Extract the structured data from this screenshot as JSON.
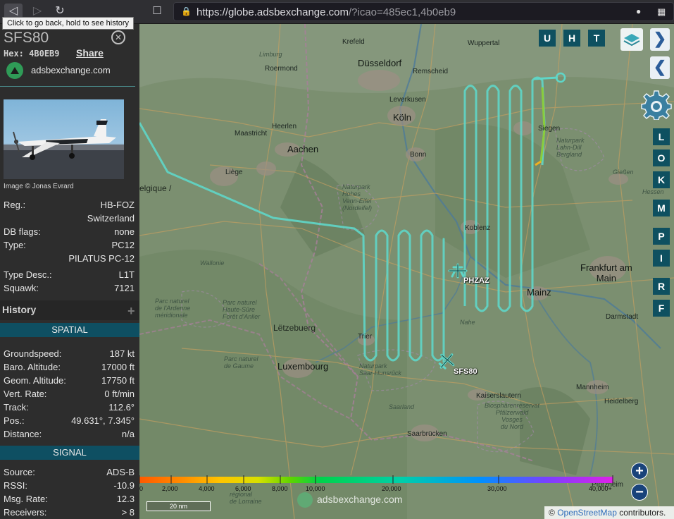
{
  "browser": {
    "url_host": "https://globe.adsbexchange.com",
    "url_path": "/?icao=485ec1,4b0eb9",
    "tooltip": "Click to go back, hold to see history"
  },
  "aircraft": {
    "callsign": "SFS80",
    "hex_label": "Hex:",
    "hex": "4B0EB9",
    "share_label": "Share",
    "site_name": "adsbexchange.com",
    "image_credit": "Image © Jonas Evrard"
  },
  "details": [
    {
      "key": "Reg.:",
      "value": "HB-FOZ"
    },
    {
      "key": "",
      "value": "Switzerland"
    },
    {
      "key": "DB flags:",
      "value": "none"
    },
    {
      "key": "Type:",
      "value": "PC12"
    },
    {
      "key": "",
      "value": "PILATUS PC-12"
    },
    {
      "key": "Type Desc.:",
      "value": "L1T"
    },
    {
      "key": "Squawk:",
      "value": "7121"
    }
  ],
  "history_label": "History",
  "spatial_label": "SPATIAL",
  "spatial": [
    {
      "key": "Groundspeed:",
      "value": "187 kt"
    },
    {
      "key": "Baro. Altitude:",
      "value": "17000 ft"
    },
    {
      "key": "Geom. Altitude:",
      "value": "17750 ft"
    },
    {
      "key": "Vert. Rate:",
      "value": "0 ft/min"
    },
    {
      "key": "Track:",
      "value": "112.6°"
    },
    {
      "key": "Pos.:",
      "value": "49.631°, 7.345°"
    },
    {
      "key": "Distance:",
      "value": "n/a"
    }
  ],
  "signal_label": "SIGNAL",
  "signal": [
    {
      "key": "Source:",
      "value": "ADS-B"
    },
    {
      "key": "RSSI:",
      "value": "-10.9"
    },
    {
      "key": "Msg. Rate:",
      "value": "12.3"
    },
    {
      "key": "Receivers:",
      "value": "> 8"
    }
  ],
  "map": {
    "buttons_top": [
      "U",
      "H",
      "T"
    ],
    "buttons_side": [
      "L",
      "O",
      "K",
      "M",
      "P",
      "I",
      "R",
      "F"
    ],
    "aircraft_labels": [
      "PHZAZ",
      "SFS80"
    ],
    "track_color": "#5fd6c8",
    "labels": {
      "krefeld": "Krefeld",
      "wuppertal": "Wuppertal",
      "limburg": "Limburg",
      "roermond": "Roermond",
      "dusseldorf": "Düsseldorf",
      "remscheid": "Remscheid",
      "leverkusen": "Leverkusen",
      "koln": "Köln",
      "heerlen": "Heerlen",
      "maastricht": "Maastricht",
      "aachen": "Aachen",
      "bonn": "Bonn",
      "liege": "Liège",
      "belgique": "elgique /",
      "siegen": "Siegen",
      "lahn": "Naturpark\nLahn-Dill\nBergland",
      "giessen": "Gießen",
      "eifel": "Naturpark\nHohes\nVenn-Eifel\n(Nordeifel)",
      "koblenz": "Koblenz",
      "frankfurt": "Frankfurt am\nMain",
      "wallonie": "Wallonie",
      "mainz": "Mainz",
      "darmstadt": "Darmstadt",
      "ardenne": "Parc naturel\nde l'Ardenne\nméridionale",
      "hautesure": "Parc naturel\nHaute-Sûre\nForêt d'Anlier",
      "letzebuerg": "Lëtzebuerg",
      "hunsruck": "Naturpark\nSaar-Hunsrück",
      "luxembourg": "Luxembourg",
      "gaume": "Parc naturel\nde Gaume",
      "trier": "Trier",
      "kaiserslautern": "Kaiserslautern",
      "pfalzer": "Biosphärenreservat\nPfälzerwald\nVosges\ndu Nord",
      "saarland": "Saarland",
      "saarbrucken": "Saarbrücken",
      "mannheim": "Mannheim",
      "heidelberg": "Heidelberg",
      "pforzheim": "Pforzheim",
      "lorraine": "régional\nde Lorraine",
      "nahe": "Nahe",
      "hessen": "Hessen"
    },
    "colorbar_ticks": [
      "0",
      "2,000",
      "4,000",
      "6,000",
      "8,000",
      "10,000",
      "20,000",
      "30,000",
      "40,000+"
    ],
    "scale_label": "20 nm",
    "watermark": "adsbexchange.com",
    "attribution_prefix": "©",
    "attribution_link": "OpenStreetMap",
    "attribution_suffix": "contributors."
  }
}
